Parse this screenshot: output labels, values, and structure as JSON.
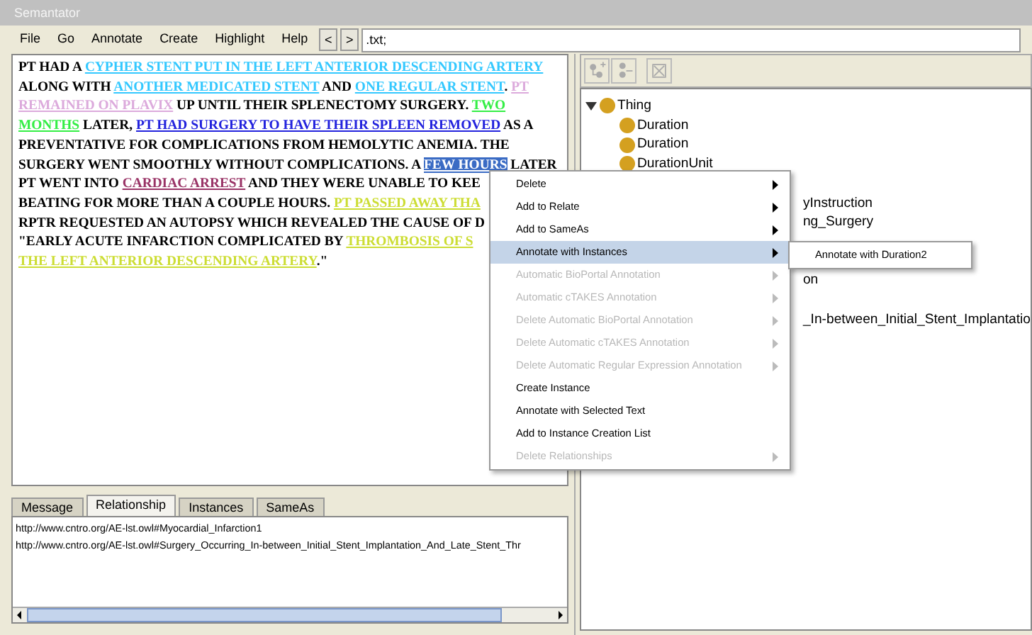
{
  "window": {
    "title": "Semantator"
  },
  "menubar": [
    {
      "label": "File"
    },
    {
      "label": "Go"
    },
    {
      "label": "Annotate"
    },
    {
      "label": "Create"
    },
    {
      "label": "Highlight"
    },
    {
      "label": "Help"
    }
  ],
  "nav_buttons": [
    "<",
    ">"
  ],
  "path_field": {
    "value": ".txt;"
  },
  "document": {
    "lines": [
      [
        {
          "kind": "plain",
          "text": "PT HAD A "
        },
        {
          "kind": "annotation",
          "text": "CYPHER STENT PUT IN THE LEFT ANTERIOR DESCENDING ARTERY",
          "color": "#33c8ff"
        }
      ],
      [
        {
          "kind": "plain",
          "text": "ALONG WITH "
        },
        {
          "kind": "annotation",
          "text": "ANOTHER MEDICATED STENT",
          "color": "#33c8ff"
        },
        {
          "kind": "plain",
          "text": " AND "
        },
        {
          "kind": "annotation",
          "text": "ONE REGULAR STENT",
          "color": "#33c8ff"
        },
        {
          "kind": "plain",
          "text": ". "
        },
        {
          "kind": "annotation",
          "text": "PT",
          "color": "#dcaadc"
        }
      ],
      [
        {
          "kind": "annotation",
          "text": "REMAINED ON PLAVIX",
          "color": "#dcaadc"
        },
        {
          "kind": "plain",
          "text": " UP UNTIL THEIR SPLENECTOMY SURGERY. "
        },
        {
          "kind": "annotation",
          "text": "TWO",
          "color": "#33ee44"
        }
      ],
      [
        {
          "kind": "annotation",
          "text": "MONTHS",
          "color": "#33ee44"
        },
        {
          "kind": "plain",
          "text": " LATER, "
        },
        {
          "kind": "annotation",
          "text": "PT HAD SURGERY TO HAVE THEIR SPLEEN REMOVED",
          "color": "#2222dd"
        },
        {
          "kind": "plain",
          "text": " AS A"
        }
      ],
      [
        {
          "kind": "plain",
          "text": "PREVENTATIVE FOR COMPLICATIONS FROM HEMOLYTIC ANEMIA. THE"
        }
      ],
      [
        {
          "kind": "plain",
          "text": "SURGERY WENT SMOOTHLY WITHOUT COMPLICATIONS. A "
        },
        {
          "kind": "selection",
          "text": "FEW HOURS"
        },
        {
          "kind": "plain",
          "text": " LATER"
        }
      ],
      [
        {
          "kind": "plain",
          "text": "PT WENT INTO "
        },
        {
          "kind": "annotation",
          "text": "CARDIAC ARREST",
          "color": "#993366"
        },
        {
          "kind": "plain",
          "text": " AND THEY WERE UNABLE TO KEE"
        }
      ],
      [
        {
          "kind": "plain",
          "text": "BEATING FOR MORE THAN A COUPLE HOURS. "
        },
        {
          "kind": "annotation",
          "text": "PT PASSED AWAY THA",
          "color": "#ccdd33"
        }
      ],
      [
        {
          "kind": "plain",
          "text": "RPTR REQUESTED AN AUTOPSY WHICH REVEALED THE CAUSE OF D"
        }
      ],
      [
        {
          "kind": "plain",
          "text": "\"EARLY ACUTE INFARCTION COMPLICATED BY "
        },
        {
          "kind": "annotation",
          "text": "THROMBOSIS OF S",
          "color": "#ccdd33"
        }
      ],
      [
        {
          "kind": "annotation",
          "text": "THE LEFT ANTERIOR DESCENDING ARTERY",
          "color": "#ccdd33"
        },
        {
          "kind": "plain",
          "text": ".\""
        }
      ]
    ]
  },
  "bottom_tabs": [
    {
      "label": "Message",
      "selected": false
    },
    {
      "label": "Relationship",
      "selected": true
    },
    {
      "label": "Instances",
      "selected": false
    },
    {
      "label": "SameAs",
      "selected": false
    }
  ],
  "relationship_list": [
    "http://www.cntro.org/AE-lst.owl#Myocardial_Infarction1",
    "http://www.cntro.org/AE-lst.owl#Surgery_Occurring_In-between_Initial_Stent_Implantation_And_Late_Stent_Thr"
  ],
  "tree": {
    "label": "Thing",
    "expanded": true,
    "children": [
      {
        "label": "Duration",
        "kind": "full"
      },
      {
        "label": "Duration",
        "kind": "full"
      },
      {
        "label": "DurationUnit",
        "kind": "full"
      },
      {
        "kind": "hidden"
      },
      {
        "label": "yInstruction",
        "kind": "partial"
      },
      {
        "label": "ng_Surgery",
        "kind": "partial"
      },
      {
        "kind": "hidden"
      },
      {
        "kind": "hidden"
      },
      {
        "label": "on",
        "kind": "partial"
      },
      {
        "kind": "hidden"
      },
      {
        "label": "_In-between_Initial_Stent_Implantatio",
        "kind": "partial"
      }
    ]
  },
  "context_menu": {
    "items": [
      {
        "label": "Delete",
        "disabled": false,
        "submenu": true,
        "selected": false
      },
      {
        "label": "Add to Relate",
        "disabled": false,
        "submenu": true,
        "selected": false
      },
      {
        "label": "Add to SameAs",
        "disabled": false,
        "submenu": true,
        "selected": false
      },
      {
        "label": "Annotate with Instances",
        "disabled": false,
        "submenu": true,
        "selected": true
      },
      {
        "label": "Automatic BioPortal Annotation",
        "disabled": true,
        "submenu": true,
        "selected": false
      },
      {
        "label": "Automatic cTAKES Annotation",
        "disabled": true,
        "submenu": true,
        "selected": false
      },
      {
        "label": "Delete Automatic BioPortal Annotation",
        "disabled": true,
        "submenu": true,
        "selected": false
      },
      {
        "label": "Delete Automatic cTAKES Annotation",
        "disabled": true,
        "submenu": true,
        "selected": false
      },
      {
        "label": "Delete Automatic Regular Expression Annotation",
        "disabled": true,
        "submenu": true,
        "selected": false
      },
      {
        "label": "Create Instance",
        "disabled": false,
        "submenu": false,
        "selected": false
      },
      {
        "label": "Annotate with Selected Text",
        "disabled": false,
        "submenu": false,
        "selected": false
      },
      {
        "label": "Add to Instance Creation List",
        "disabled": false,
        "submenu": false,
        "selected": false
      },
      {
        "label": "Delete Relationships",
        "disabled": true,
        "submenu": true,
        "selected": false
      }
    ]
  },
  "submenu": {
    "items": [
      "Annotate with Duration2"
    ]
  }
}
